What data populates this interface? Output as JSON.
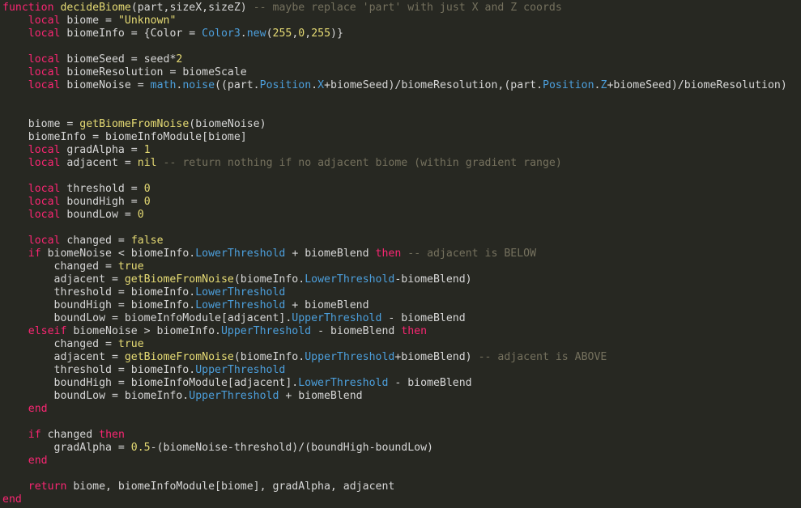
{
  "editor": {
    "lines": [
      [
        [
          "kw",
          "function"
        ],
        [
          "tx",
          " "
        ],
        [
          "fn",
          "decideBiome"
        ],
        [
          "tx",
          "(part,sizeX,sizeZ) "
        ],
        [
          "cm",
          "-- maybe replace 'part' with just X and Z coords"
        ]
      ],
      [
        [
          "tx",
          "    "
        ],
        [
          "kw",
          "local"
        ],
        [
          "tx",
          " biome = "
        ],
        [
          "str",
          "\"Unknown\""
        ]
      ],
      [
        [
          "tx",
          "    "
        ],
        [
          "kw",
          "local"
        ],
        [
          "tx",
          " biomeInfo = {Color = "
        ],
        [
          "prop",
          "Color3"
        ],
        [
          "tx",
          "."
        ],
        [
          "prop",
          "new"
        ],
        [
          "tx",
          "("
        ],
        [
          "num",
          "255"
        ],
        [
          "tx",
          ","
        ],
        [
          "num",
          "0"
        ],
        [
          "tx",
          ","
        ],
        [
          "num",
          "255"
        ],
        [
          "tx",
          ")}"
        ]
      ],
      [],
      [
        [
          "tx",
          "    "
        ],
        [
          "kw",
          "local"
        ],
        [
          "tx",
          " biomeSeed = seed*"
        ],
        [
          "num",
          "2"
        ]
      ],
      [
        [
          "tx",
          "    "
        ],
        [
          "kw",
          "local"
        ],
        [
          "tx",
          " biomeResolution = biomeScale"
        ]
      ],
      [
        [
          "tx",
          "    "
        ],
        [
          "kw",
          "local"
        ],
        [
          "tx",
          " biomeNoise = "
        ],
        [
          "prop",
          "math"
        ],
        [
          "tx",
          "."
        ],
        [
          "prop",
          "noise"
        ],
        [
          "tx",
          "((part."
        ],
        [
          "prop",
          "Position"
        ],
        [
          "tx",
          "."
        ],
        [
          "prop",
          "X"
        ],
        [
          "tx",
          "+biomeSeed)/biomeResolution,(part."
        ],
        [
          "prop",
          "Position"
        ],
        [
          "tx",
          "."
        ],
        [
          "prop",
          "Z"
        ],
        [
          "tx",
          "+biomeSeed)/biomeResolution)"
        ]
      ],
      [],
      [],
      [
        [
          "tx",
          "    biome = "
        ],
        [
          "fn",
          "getBiomeFromNoise"
        ],
        [
          "tx",
          "(biomeNoise)"
        ]
      ],
      [
        [
          "tx",
          "    biomeInfo = biomeInfoModule[biome]"
        ]
      ],
      [
        [
          "tx",
          "    "
        ],
        [
          "kw",
          "local"
        ],
        [
          "tx",
          " gradAlpha = "
        ],
        [
          "num",
          "1"
        ]
      ],
      [
        [
          "tx",
          "    "
        ],
        [
          "kw",
          "local"
        ],
        [
          "tx",
          " adjacent = "
        ],
        [
          "lit",
          "nil"
        ],
        [
          "tx",
          " "
        ],
        [
          "cm",
          "-- return nothing if no adjacent biome (within gradient range)"
        ]
      ],
      [],
      [
        [
          "tx",
          "    "
        ],
        [
          "kw",
          "local"
        ],
        [
          "tx",
          " threshold = "
        ],
        [
          "num",
          "0"
        ]
      ],
      [
        [
          "tx",
          "    "
        ],
        [
          "kw",
          "local"
        ],
        [
          "tx",
          " boundHigh = "
        ],
        [
          "num",
          "0"
        ]
      ],
      [
        [
          "tx",
          "    "
        ],
        [
          "kw",
          "local"
        ],
        [
          "tx",
          " boundLow = "
        ],
        [
          "num",
          "0"
        ]
      ],
      [],
      [
        [
          "tx",
          "    "
        ],
        [
          "kw",
          "local"
        ],
        [
          "tx",
          " changed = "
        ],
        [
          "lit",
          "false"
        ]
      ],
      [
        [
          "tx",
          "    "
        ],
        [
          "kw",
          "if"
        ],
        [
          "tx",
          " biomeNoise < biomeInfo."
        ],
        [
          "prop",
          "LowerThreshold"
        ],
        [
          "tx",
          " + biomeBlend "
        ],
        [
          "kw",
          "then"
        ],
        [
          "tx",
          " "
        ],
        [
          "cm",
          "-- adjacent is BELOW"
        ]
      ],
      [
        [
          "tx",
          "        changed = "
        ],
        [
          "lit",
          "true"
        ]
      ],
      [
        [
          "tx",
          "        adjacent = "
        ],
        [
          "fn",
          "getBiomeFromNoise"
        ],
        [
          "tx",
          "(biomeInfo."
        ],
        [
          "prop",
          "LowerThreshold"
        ],
        [
          "tx",
          "-biomeBlend)"
        ]
      ],
      [
        [
          "tx",
          "        threshold = biomeInfo."
        ],
        [
          "prop",
          "LowerThreshold"
        ]
      ],
      [
        [
          "tx",
          "        boundHigh = biomeInfo."
        ],
        [
          "prop",
          "LowerThreshold"
        ],
        [
          "tx",
          " + biomeBlend"
        ]
      ],
      [
        [
          "tx",
          "        boundLow = biomeInfoModule[adjacent]."
        ],
        [
          "prop",
          "UpperThreshold"
        ],
        [
          "tx",
          " - biomeBlend"
        ]
      ],
      [
        [
          "tx",
          "    "
        ],
        [
          "kw",
          "elseif"
        ],
        [
          "tx",
          " biomeNoise > biomeInfo."
        ],
        [
          "prop",
          "UpperThreshold"
        ],
        [
          "tx",
          " - biomeBlend "
        ],
        [
          "kw",
          "then"
        ]
      ],
      [
        [
          "tx",
          "        changed = "
        ],
        [
          "lit",
          "true"
        ]
      ],
      [
        [
          "tx",
          "        adjacent = "
        ],
        [
          "fn",
          "getBiomeFromNoise"
        ],
        [
          "tx",
          "(biomeInfo."
        ],
        [
          "prop",
          "UpperThreshold"
        ],
        [
          "tx",
          "+biomeBlend) "
        ],
        [
          "cm",
          "-- adjacent is ABOVE"
        ]
      ],
      [
        [
          "tx",
          "        threshold = biomeInfo."
        ],
        [
          "prop",
          "UpperThreshold"
        ]
      ],
      [
        [
          "tx",
          "        boundHigh = biomeInfoModule[adjacent]."
        ],
        [
          "prop",
          "LowerThreshold"
        ],
        [
          "tx",
          " - biomeBlend"
        ]
      ],
      [
        [
          "tx",
          "        boundLow = biomeInfo."
        ],
        [
          "prop",
          "UpperThreshold"
        ],
        [
          "tx",
          " + biomeBlend"
        ]
      ],
      [
        [
          "tx",
          "    "
        ],
        [
          "kw",
          "end"
        ]
      ],
      [],
      [
        [
          "tx",
          "    "
        ],
        [
          "kw",
          "if"
        ],
        [
          "tx",
          " changed "
        ],
        [
          "kw",
          "then"
        ]
      ],
      [
        [
          "tx",
          "        gradAlpha = "
        ],
        [
          "num",
          "0.5"
        ],
        [
          "tx",
          "-(biomeNoise-threshold)/(boundHigh-boundLow)"
        ]
      ],
      [
        [
          "tx",
          "    "
        ],
        [
          "kw",
          "end"
        ]
      ],
      [],
      [
        [
          "tx",
          "    "
        ],
        [
          "kw",
          "return"
        ],
        [
          "tx",
          " biome, biomeInfoModule[biome], gradAlpha, adjacent"
        ]
      ],
      [
        [
          "kw",
          "end"
        ]
      ]
    ]
  }
}
